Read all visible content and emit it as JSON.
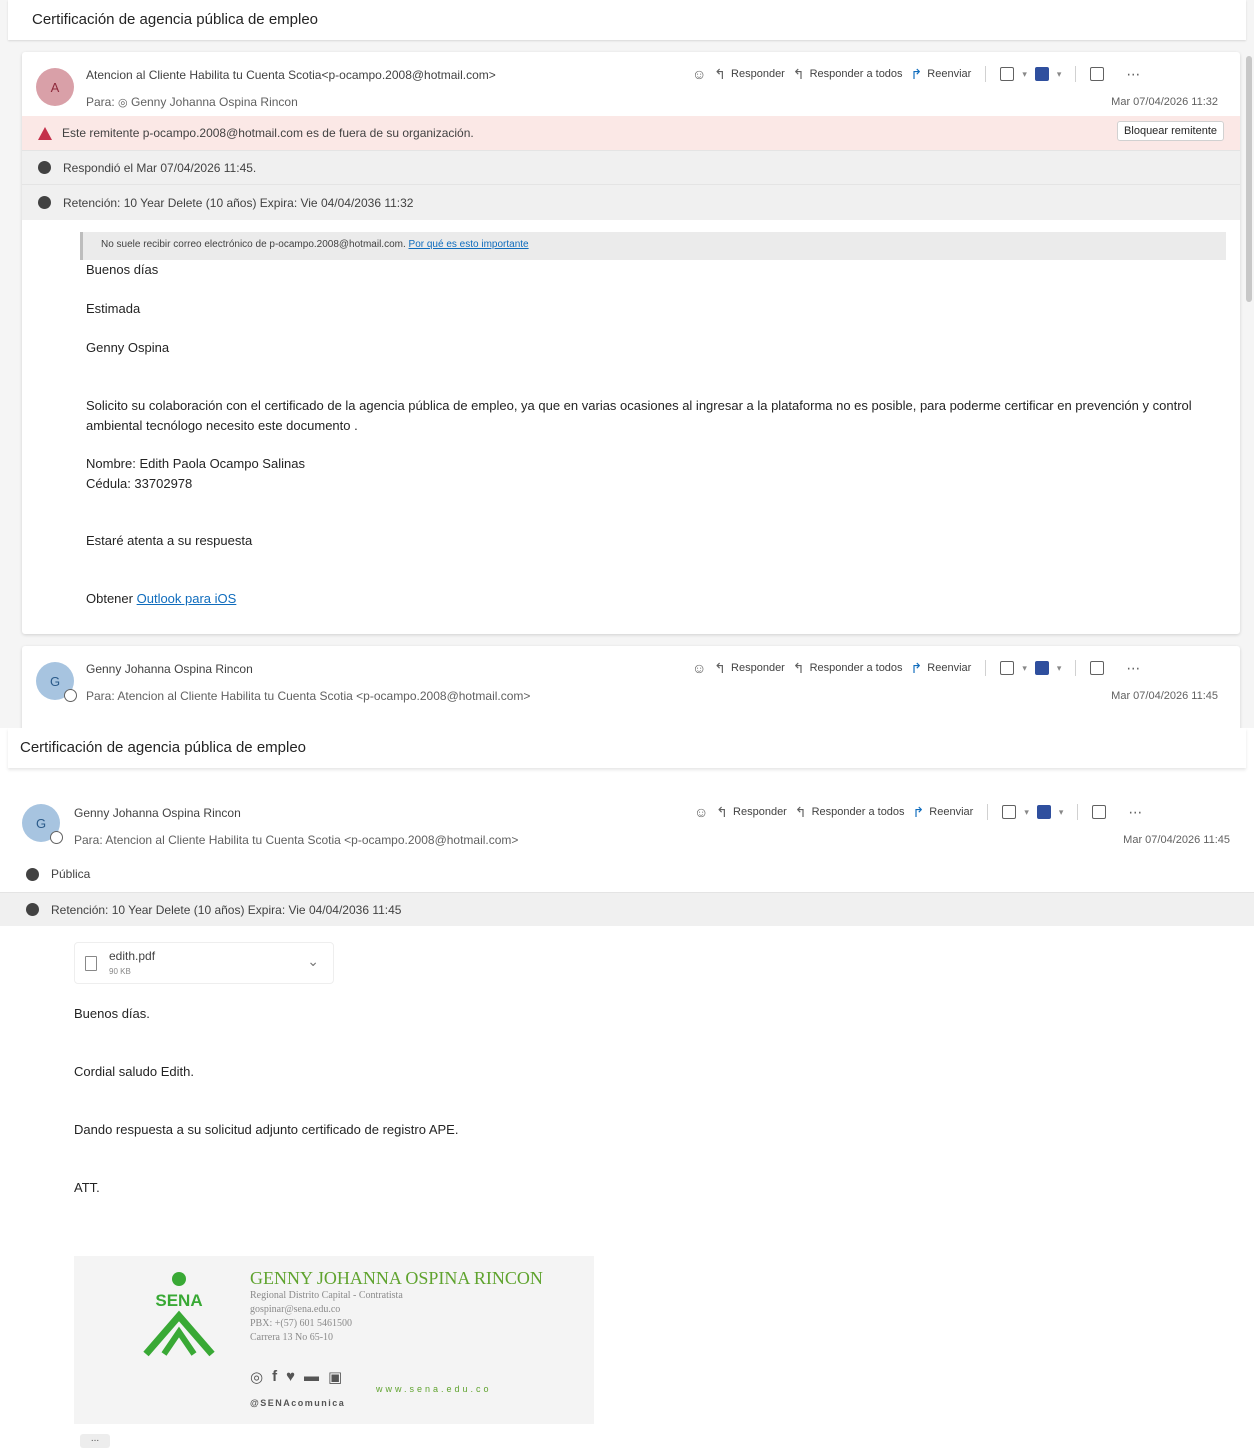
{
  "subject": "Certificación de agencia pública de empleo",
  "toolbar": {
    "reply": "Responder",
    "reply_all": "Responder a todos",
    "forward": "Reenviar"
  },
  "message1": {
    "avatar_initial": "A",
    "from": "Atencion al Cliente Habilita tu Cuenta Scotia<p-ocampo.2008@hotmail.com>",
    "to_label": "Para:",
    "to": "Genny Johanna Ospina Rincon",
    "date": "Mar 07/04/2026 11:32",
    "warning": "Este remitente p-ocampo.2008@hotmail.com es de fuera de su organización.",
    "block_button": "Bloquear remitente",
    "replied": "Respondió el Mar 07/04/2026 11:45.",
    "retention": "Retención: 10 Year Delete (10 años) Expira: Vie 04/04/2036 11:32",
    "notice_text": "No suele recibir correo electrónico de p-ocampo.2008@hotmail.com.",
    "notice_link": "Por qué es esto importante",
    "body": {
      "greeting": "Buenos días",
      "salutation": "Estimada",
      "name": "Genny Ospina",
      "paragraph": "Solicito su colaboración con el certificado de la agencia pública de empleo, ya que en varias ocasiones  al ingresar a la plataforma no es posible, para poderme certificar en prevención y control ambiental tecnólogo  necesito este documento .",
      "nombre": "Nombre: Edith Paola Ocampo Salinas",
      "cedula": "Cédula: 33702978",
      "closing": "Estaré atenta a su respuesta",
      "get_prefix": "Obtener",
      "get_link": "Outlook para iOS"
    }
  },
  "message2": {
    "avatar_initial": "G",
    "from": "Genny Johanna Ospina Rincon",
    "to_label": "Para:",
    "to": "Atencion al Cliente Habilita tu Cuenta Scotia <p-ocampo.2008@hotmail.com>",
    "date": "Mar 07/04/2026 11:45",
    "sensitivity": "Pública",
    "retention": "Retención: 10 Year Delete (10 años) Expira: Vie 04/04/2036 11:45",
    "attachment": {
      "name": "edith.pdf",
      "size": "90 KB"
    },
    "body": {
      "greeting": "Buenos días.",
      "salutation": "Cordial saludo Edith.",
      "paragraph": "Dando respuesta a su solicitud adjunto certificado de registro APE.",
      "signoff": "ATT."
    },
    "signature": {
      "logo_text": "SENA",
      "name": "GENNY JOHANNA OSPINA RINCON",
      "role": "Regional Distrito Capital - Contratista",
      "email": "gospinar@sena.edu.co",
      "phone": "PBX: +(57) 601 5461500",
      "address": "Carrera 13 No 65-10",
      "handle": "@SENAcomunica",
      "web": "www.sena.edu.co"
    },
    "more": "..."
  }
}
